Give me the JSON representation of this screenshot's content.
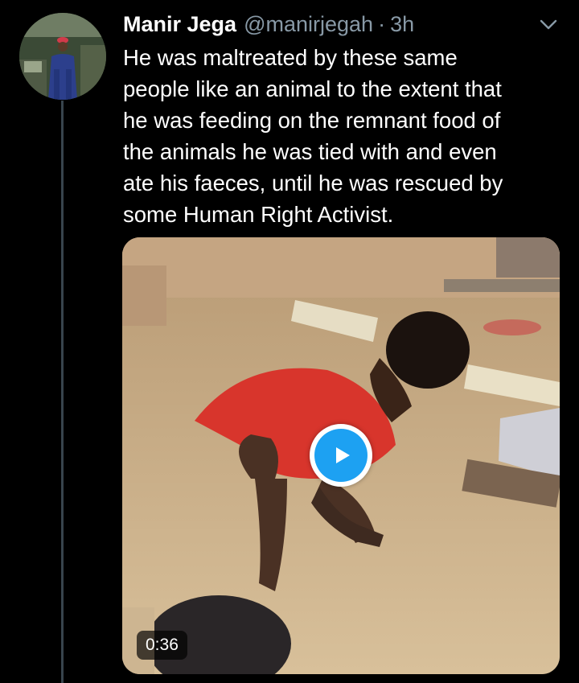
{
  "tweet": {
    "author_name": "Manir Jega",
    "author_handle": "@manirjegah",
    "separator": "·",
    "time": "3h",
    "text": "He was maltreated by these same\npeople like an animal to the extent that\nhe was feeding on the remnant food of\nthe animals he was tied with and even\nate his faeces, until he was rescued by\nsome Human Right Activist.",
    "media": {
      "type": "video",
      "duration": "0:36",
      "play_icon": "play-icon"
    }
  },
  "icons": {
    "caret": "chevron-down-icon",
    "avatar": "avatar"
  },
  "colors": {
    "background": "#000000",
    "secondary_text": "#8899a6",
    "thread_line": "#38444d",
    "accent": "#1da1f2"
  }
}
